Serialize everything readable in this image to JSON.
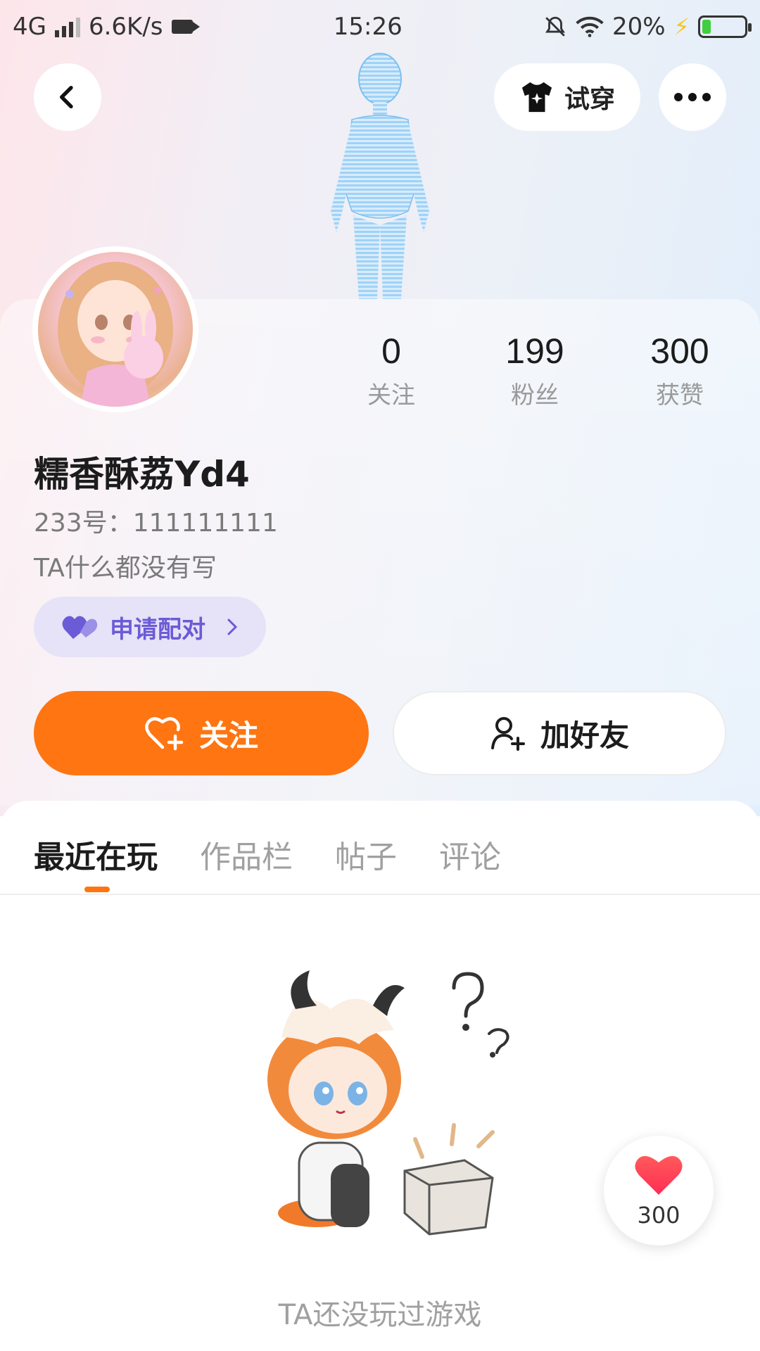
{
  "status_bar": {
    "network": "4G",
    "speed": "6.6K/s",
    "time": "15:26",
    "battery": "20%",
    "battery_level": 0.2
  },
  "header": {
    "back_icon": "chevron-left-icon",
    "tryon_label": "试穿",
    "tryon_icon": "shirt-sparkle-icon",
    "more_icon": "more-dots-icon"
  },
  "stats": [
    {
      "value": "0",
      "label": "关注"
    },
    {
      "value": "199",
      "label": "粉丝"
    },
    {
      "value": "300",
      "label": "获赞"
    }
  ],
  "profile": {
    "nickname": "糯香酥荔Yd4",
    "uid": "233号：111111111",
    "bio": "TA什么都没有写",
    "pair_label": "申请配对",
    "pair_icon": "hearts-icon"
  },
  "actions": {
    "follow_label": "关注",
    "follow_icon": "heart-plus-icon",
    "add_friend_label": "加好友",
    "add_friend_icon": "user-plus-icon"
  },
  "tabs": [
    {
      "label": "最近在玩",
      "active": true
    },
    {
      "label": "作品栏",
      "active": false
    },
    {
      "label": "帖子",
      "active": false
    },
    {
      "label": "评论",
      "active": false
    }
  ],
  "empty_state": {
    "message": "TA还没玩过游戏"
  },
  "like_fab": {
    "count": "300",
    "icon": "heart-icon"
  },
  "colors": {
    "accent": "#fe7512",
    "pair_bg": "#e6e2f7",
    "pair_text": "#6b5bd6"
  }
}
